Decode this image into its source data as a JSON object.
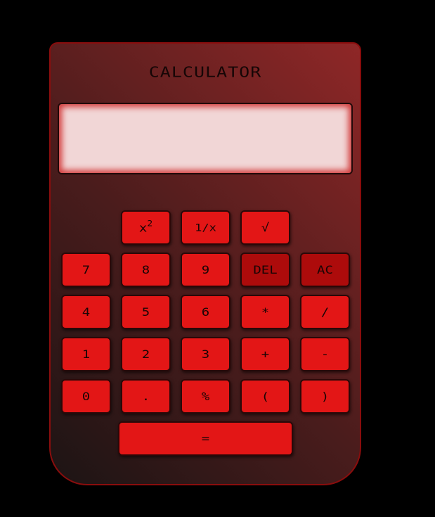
{
  "app": {
    "title": "CALCULATOR",
    "display_value": ""
  },
  "keys": {
    "square": {
      "base": "x",
      "sup": "2"
    },
    "reciprocal": "1/x",
    "sqrt": "√",
    "k7": "7",
    "k8": "8",
    "k9": "9",
    "del": "DEL",
    "ac": "AC",
    "k4": "4",
    "k5": "5",
    "k6": "6",
    "multiply": "*",
    "divide": "/",
    "k1": "1",
    "k2": "2",
    "k3": "3",
    "plus": "+",
    "minus": "-",
    "k0": "0",
    "dot": ".",
    "percent": "%",
    "lparen": "(",
    "rparen": ")",
    "equals": "="
  },
  "colors": {
    "key": "#e31616",
    "key_dark": "#ad0b0b",
    "display_bg": "#f1d6d6",
    "body_dark": "#1c1414",
    "body_light": "#8f2727"
  }
}
